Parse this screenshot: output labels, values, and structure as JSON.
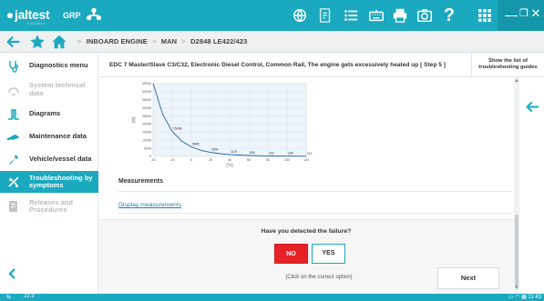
{
  "app": {
    "logo_text": "jaltest",
    "logo_sub": "COJALI",
    "product": "GRP"
  },
  "colors": {
    "accent": "#1aa9bf",
    "danger": "#e62227",
    "link": "#1a7fb8"
  },
  "topbar": {
    "icons": [
      "language-icon",
      "report-icon",
      "list-icon",
      "keyboard-icon",
      "print-icon",
      "camera-icon",
      "help-icon",
      "apps-grid-icon"
    ],
    "window_buttons": {
      "minimize": "—",
      "restore": "❐",
      "close": "✕"
    }
  },
  "breadcrumb": {
    "items": [
      "INBOARD ENGINE",
      "MAN",
      "D2848 LE422/423"
    ],
    "separator": ">"
  },
  "sidebar": {
    "items": [
      {
        "label": "Diagnostics menu",
        "icon": "diagnostics-icon",
        "state": "normal"
      },
      {
        "label": "System technical data",
        "icon": "technical-data-icon",
        "state": "disabled"
      },
      {
        "label": "Diagrams",
        "icon": "diagrams-icon",
        "state": "normal"
      },
      {
        "label": "Maintenance data",
        "icon": "maintenance-icon",
        "state": "normal"
      },
      {
        "label": "Vehicle/vessel data",
        "icon": "vehicle-data-icon",
        "state": "normal"
      },
      {
        "label": "Troubleshooting by symptoms",
        "icon": "troubleshooting-icon",
        "state": "active"
      },
      {
        "label": "Releases and Procedures",
        "icon": "procedures-icon",
        "state": "disabled"
      }
    ]
  },
  "page": {
    "title": "EDC 7 Master/Slave C3/C32, Electronic Diesel Control, Common Rail, The engine gets excessively heated up [ Step 5 ]",
    "guides_button": "Show the list of troubleshooting guides"
  },
  "measurements": {
    "title": "Measurements",
    "link": "Display measurements"
  },
  "question": {
    "text": "Have you detected the failure?",
    "no_label": "NO",
    "yes_label": "YES",
    "selected": "NO",
    "hint": "(Click on the correct option)",
    "next_label": "Next"
  },
  "statusbar": {
    "version": "22.3",
    "time": "11:43"
  },
  "chart_data": {
    "type": "line",
    "ylabel": "[Ω]",
    "xlabel": "[°C]",
    "x_ticks": [
      -40,
      -20,
      0,
      20,
      40,
      60,
      80,
      100,
      120
    ],
    "y_ticks": [
      0,
      5000,
      10000,
      15000,
      20000,
      25000,
      30000,
      35000,
      40000,
      45000
    ],
    "xlim": [
      -40,
      120
    ],
    "ylim": [
      0,
      45000
    ],
    "series": [
      {
        "x": [
          -40,
          -30,
          -20,
          -10,
          0,
          10,
          20,
          30,
          40,
          50,
          60,
          70,
          80,
          90,
          100,
          110,
          120
        ],
        "values": [
          45303,
          26108,
          15458,
          9395,
          5896,
          3792,
          2500,
          1707,
          1175,
          834,
          596,
          436,
          323,
          245,
          186,
          144,
          113
        ]
      }
    ],
    "data_labels": [
      {
        "x": -20,
        "y": 15458,
        "text": "15458"
      },
      {
        "x": 0,
        "y": 5896,
        "text": "5896"
      },
      {
        "x": 20,
        "y": 2500,
        "text": "2500"
      },
      {
        "x": 40,
        "y": 1175,
        "text": "1175"
      },
      {
        "x": 60,
        "y": 596,
        "text": "596"
      },
      {
        "x": 80,
        "y": 323,
        "text": "323"
      },
      {
        "x": 100,
        "y": 186,
        "text": "186"
      },
      {
        "x": 120,
        "y": 113,
        "text": "113"
      }
    ]
  }
}
